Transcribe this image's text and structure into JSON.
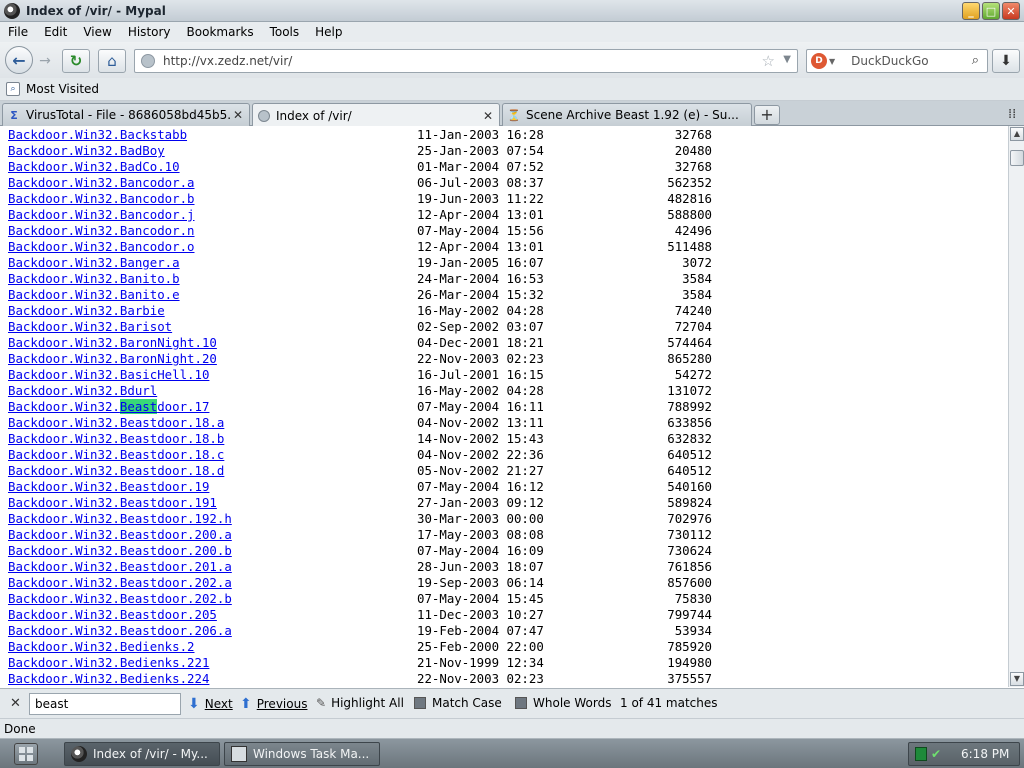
{
  "window": {
    "title": "Index of /vir/ - Mypal",
    "controls": {
      "minimize": "_",
      "maximize": "□",
      "close": "✕"
    }
  },
  "menu": [
    "File",
    "Edit",
    "View",
    "History",
    "Bookmarks",
    "Tools",
    "Help"
  ],
  "navbar": {
    "url": "http://vx.zedz.net/vir/",
    "search_placeholder": "DuckDuckGo"
  },
  "bookmarks_bar": {
    "label": "Most Visited"
  },
  "tabs": [
    {
      "label": "VirusTotal - File - 8686058bd45b5...",
      "icon": "virustotal-icon",
      "active": false
    },
    {
      "label": "Index of /vir/",
      "icon": "globe-icon",
      "active": true
    },
    {
      "label": "Scene Archive Beast 1.92 (e) - Su...",
      "icon": "archive-icon",
      "active": false
    }
  ],
  "listing": [
    {
      "name": "Backdoor.Win32.Backstabb",
      "date": "11-Jan-2003 16:28",
      "size": "32768"
    },
    {
      "name": "Backdoor.Win32.BadBoy",
      "date": "25-Jan-2003 07:54",
      "size": "20480"
    },
    {
      "name": "Backdoor.Win32.BadCo.10",
      "date": "01-Mar-2004 07:52",
      "size": "32768"
    },
    {
      "name": "Backdoor.Win32.Bancodor.a",
      "date": "06-Jul-2003 08:37",
      "size": "562352"
    },
    {
      "name": "Backdoor.Win32.Bancodor.b",
      "date": "19-Jun-2003 11:22",
      "size": "482816"
    },
    {
      "name": "Backdoor.Win32.Bancodor.j",
      "date": "12-Apr-2004 13:01",
      "size": "588800"
    },
    {
      "name": "Backdoor.Win32.Bancodor.n",
      "date": "07-May-2004 15:56",
      "size": "42496"
    },
    {
      "name": "Backdoor.Win32.Bancodor.o",
      "date": "12-Apr-2004 13:01",
      "size": "511488"
    },
    {
      "name": "Backdoor.Win32.Banger.a",
      "date": "19-Jan-2005 16:07",
      "size": "3072"
    },
    {
      "name": "Backdoor.Win32.Banito.b",
      "date": "24-Mar-2004 16:53",
      "size": "3584"
    },
    {
      "name": "Backdoor.Win32.Banito.e",
      "date": "26-Mar-2004 15:32",
      "size": "3584"
    },
    {
      "name": "Backdoor.Win32.Barbie",
      "date": "16-May-2002 04:28",
      "size": "74240"
    },
    {
      "name": "Backdoor.Win32.Barisot",
      "date": "02-Sep-2002 03:07",
      "size": "72704"
    },
    {
      "name": "Backdoor.Win32.BaronNight.10",
      "date": "04-Dec-2001 18:21",
      "size": "574464"
    },
    {
      "name": "Backdoor.Win32.BaronNight.20",
      "date": "22-Nov-2003 02:23",
      "size": "865280"
    },
    {
      "name": "Backdoor.Win32.BasicHell.10",
      "date": "16-Jul-2001 16:15",
      "size": "54272"
    },
    {
      "name": "Backdoor.Win32.Bdurl",
      "date": "16-May-2002 04:28",
      "size": "131072"
    },
    {
      "name": "Backdoor.Win32.Beastdoor.17",
      "date": "07-May-2004 16:11",
      "size": "788992",
      "highlight": true
    },
    {
      "name": "Backdoor.Win32.Beastdoor.18.a",
      "date": "04-Nov-2002 13:11",
      "size": "633856"
    },
    {
      "name": "Backdoor.Win32.Beastdoor.18.b",
      "date": "14-Nov-2002 15:43",
      "size": "632832"
    },
    {
      "name": "Backdoor.Win32.Beastdoor.18.c",
      "date": "04-Nov-2002 22:36",
      "size": "640512"
    },
    {
      "name": "Backdoor.Win32.Beastdoor.18.d",
      "date": "05-Nov-2002 21:27",
      "size": "640512"
    },
    {
      "name": "Backdoor.Win32.Beastdoor.19",
      "date": "07-May-2004 16:12",
      "size": "540160"
    },
    {
      "name": "Backdoor.Win32.Beastdoor.191",
      "date": "27-Jan-2003 09:12",
      "size": "589824"
    },
    {
      "name": "Backdoor.Win32.Beastdoor.192.h",
      "date": "30-Mar-2003 00:00",
      "size": "702976"
    },
    {
      "name": "Backdoor.Win32.Beastdoor.200.a",
      "date": "17-May-2003 08:08",
      "size": "730112"
    },
    {
      "name": "Backdoor.Win32.Beastdoor.200.b",
      "date": "07-May-2004 16:09",
      "size": "730624"
    },
    {
      "name": "Backdoor.Win32.Beastdoor.201.a",
      "date": "28-Jun-2003 18:07",
      "size": "761856"
    },
    {
      "name": "Backdoor.Win32.Beastdoor.202.a",
      "date": "19-Sep-2003 06:14",
      "size": "857600"
    },
    {
      "name": "Backdoor.Win32.Beastdoor.202.b",
      "date": "07-May-2004 15:45",
      "size": "75830"
    },
    {
      "name": "Backdoor.Win32.Beastdoor.205",
      "date": "11-Dec-2003 10:27",
      "size": "799744"
    },
    {
      "name": "Backdoor.Win32.Beastdoor.206.a",
      "date": "19-Feb-2004 07:47",
      "size": "53934"
    },
    {
      "name": "Backdoor.Win32.Bedienks.2",
      "date": "25-Feb-2000 22:00",
      "size": "785920"
    },
    {
      "name": "Backdoor.Win32.Bedienks.221",
      "date": "21-Nov-1999 12:34",
      "size": "194980"
    },
    {
      "name": "Backdoor.Win32.Bedienks.224",
      "date": "22-Nov-2003 02:23",
      "size": "375557"
    }
  ],
  "findbar": {
    "query": "beast",
    "next": "Next",
    "previous": "Previous",
    "highlight_all": "Highlight All",
    "match_case": "Match Case",
    "whole_words": "Whole Words",
    "match_status": "1 of 41 matches"
  },
  "statusbar": {
    "text": "Done"
  },
  "taskbar": {
    "tasks": [
      {
        "label": "Index of /vir/ - My...",
        "active": true
      },
      {
        "label": "Windows Task Ma...",
        "active": false
      }
    ],
    "clock": "6:18 PM"
  },
  "colors": {
    "link": "#0000ee",
    "find_highlight": "#38d878"
  }
}
